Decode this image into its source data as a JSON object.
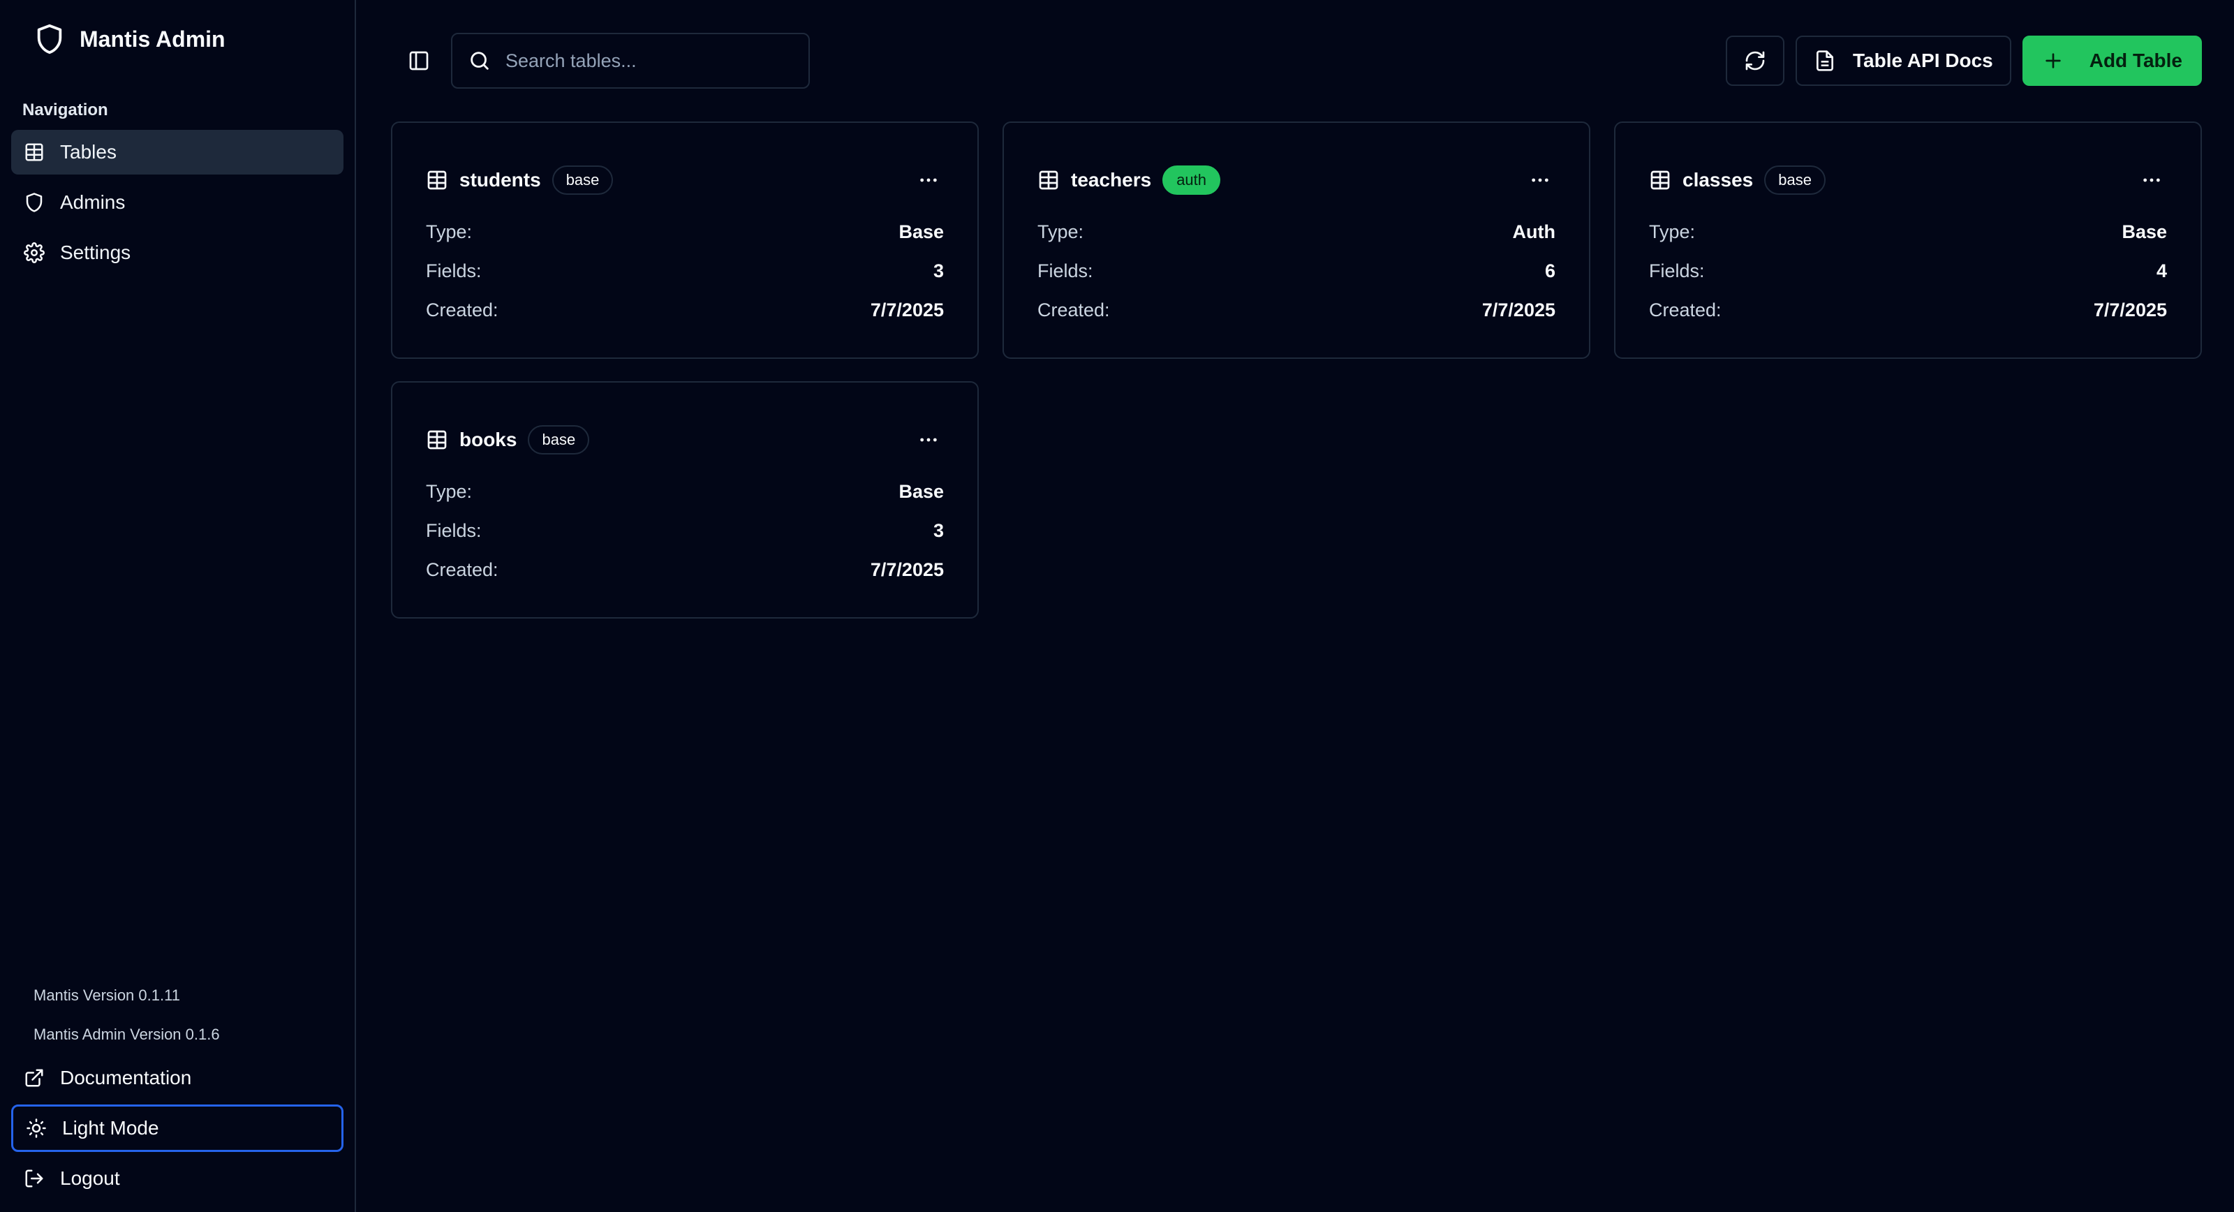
{
  "brand": {
    "title": "Mantis Admin"
  },
  "nav": {
    "label": "Navigation",
    "items": [
      {
        "label": "Tables"
      },
      {
        "label": "Admins"
      },
      {
        "label": "Settings"
      }
    ]
  },
  "footer": {
    "mantis_version": "Mantis Version 0.1.11",
    "admin_version": "Mantis Admin Version 0.1.6",
    "documentation": "Documentation",
    "light_mode": "Light Mode",
    "logout": "Logout"
  },
  "search": {
    "placeholder": "Search tables..."
  },
  "actions": {
    "docs": "Table API Docs",
    "add": "Add Table"
  },
  "labels": {
    "type": "Type:",
    "fields": "Fields:",
    "created": "Created:"
  },
  "tables": [
    {
      "name": "students",
      "badge": "base",
      "type": "Base",
      "fields": "3",
      "created": "7/7/2025"
    },
    {
      "name": "teachers",
      "badge": "auth",
      "type": "Auth",
      "fields": "6",
      "created": "7/7/2025"
    },
    {
      "name": "classes",
      "badge": "base",
      "type": "Base",
      "fields": "4",
      "created": "7/7/2025"
    },
    {
      "name": "books",
      "badge": "base",
      "type": "Base",
      "fields": "3",
      "created": "7/7/2025"
    }
  ],
  "colors": {
    "accent": "#22c55e",
    "background": "#020617",
    "border": "#1e293b",
    "focus": "#2563eb"
  },
  "icons": [
    "shield-icon",
    "table-icon",
    "gear-icon",
    "sidebar-toggle-icon",
    "search-icon",
    "refresh-icon",
    "file-icon",
    "plus-icon",
    "more-icon",
    "external-link-icon",
    "sun-icon",
    "logout-icon"
  ]
}
